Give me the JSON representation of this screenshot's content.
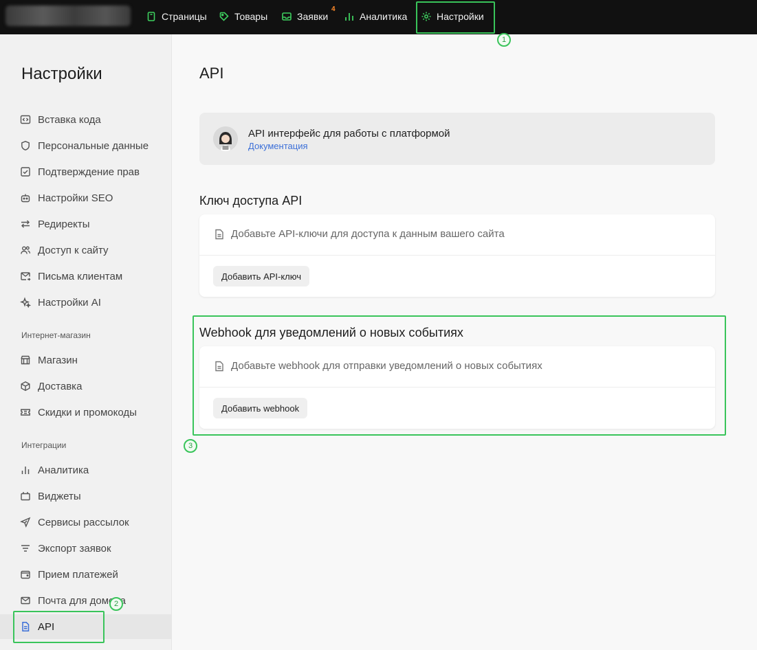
{
  "header": {
    "nav": [
      {
        "label": "Страницы",
        "icon": "file-icon"
      },
      {
        "label": "Товары",
        "icon": "tag-icon"
      },
      {
        "label": "Заявки",
        "icon": "inbox-icon",
        "badge": "4"
      },
      {
        "label": "Аналитика",
        "icon": "bar-chart-icon"
      },
      {
        "label": "Настройки",
        "icon": "gear-icon"
      }
    ]
  },
  "annotations": [
    "1",
    "2",
    "3"
  ],
  "sidebar": {
    "title": "Настройки",
    "items": [
      {
        "label": "Вставка кода",
        "icon": "code-icon"
      },
      {
        "label": "Персональные данные",
        "icon": "shield-icon"
      },
      {
        "label": "Подтверждение прав",
        "icon": "checkbox-icon"
      },
      {
        "label": "Настройки SEO",
        "icon": "robot-icon"
      },
      {
        "label": "Редиректы",
        "icon": "swap-arrows-icon"
      },
      {
        "label": "Доступ к сайту",
        "icon": "users-icon"
      },
      {
        "label": "Письма клиентам",
        "icon": "mail-send-icon"
      },
      {
        "label": "Настройки AI",
        "icon": "sparkles-icon"
      }
    ],
    "section_shop": "Интернет-магазин",
    "shop_items": [
      {
        "label": "Магазин",
        "icon": "store-icon"
      },
      {
        "label": "Доставка",
        "icon": "box-icon"
      },
      {
        "label": "Скидки и промокоды",
        "icon": "ticket-icon"
      }
    ],
    "section_integrations": "Интеграции",
    "integration_items": [
      {
        "label": "Аналитика",
        "icon": "bar-chart-icon"
      },
      {
        "label": "Виджеты",
        "icon": "widget-icon"
      },
      {
        "label": "Сервисы рассылок",
        "icon": "paper-plane-icon"
      },
      {
        "label": "Экспорт заявок",
        "icon": "filter-icon"
      },
      {
        "label": "Прием платежей",
        "icon": "wallet-icon"
      },
      {
        "label": "Почта для домена",
        "icon": "envelope-icon"
      },
      {
        "label": "API",
        "icon": "document-icon"
      }
    ]
  },
  "main": {
    "title": "API",
    "info": {
      "title": "API интерфейс для работы с платформой",
      "link": "Документация"
    },
    "api_keys": {
      "heading": "Ключ доступа API",
      "hint": "Добавьте API-ключи для доступа к данным вашего сайта",
      "button": "Добавить API-ключ"
    },
    "webhook": {
      "heading": "Webhook для уведомлений о новых событиях",
      "hint": "Добавьте webhook для отправки уведомлений о новых событиях",
      "button": "Добавить webhook"
    }
  },
  "colors": {
    "accent_green": "#39c45a",
    "link_blue": "#3b6fd8",
    "badge_orange": "#ff8a2a",
    "topbar_bg": "#111111"
  }
}
